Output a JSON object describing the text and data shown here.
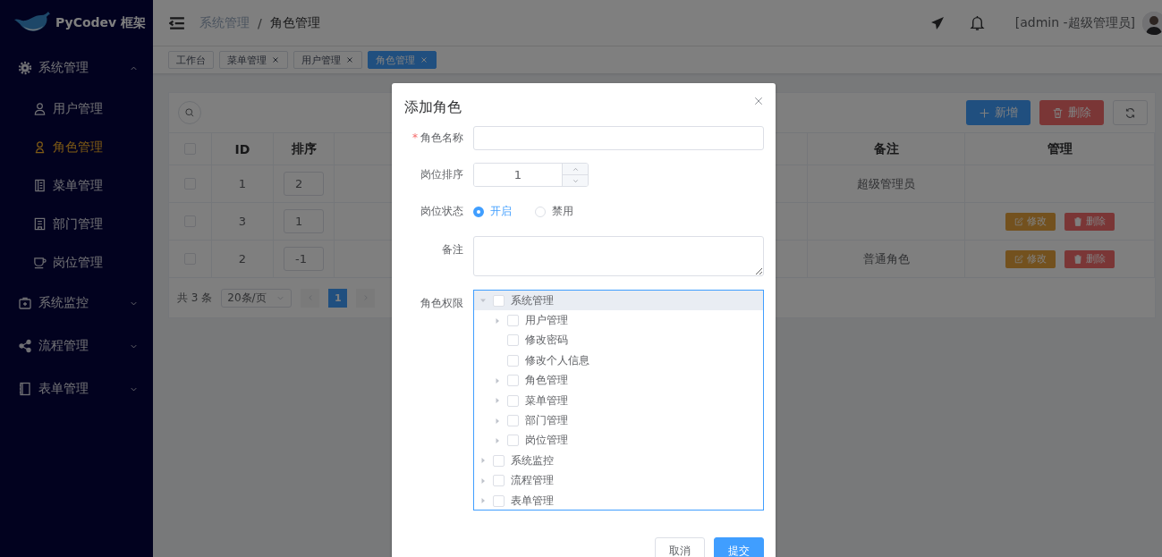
{
  "sidebar": {
    "logo": "PyCodev 框架",
    "items": [
      {
        "label": "系统管理",
        "expanded": true,
        "children": [
          {
            "label": "用户管理",
            "selected": false
          },
          {
            "label": "角色管理",
            "selected": true
          },
          {
            "label": "菜单管理",
            "selected": false
          },
          {
            "label": "部门管理",
            "selected": false
          },
          {
            "label": "岗位管理",
            "selected": false
          }
        ]
      },
      {
        "label": "系统监控",
        "expanded": false
      },
      {
        "label": "流程管理",
        "expanded": false
      },
      {
        "label": "表单管理",
        "expanded": false
      }
    ]
  },
  "header": {
    "breadcrumb": [
      "系统管理",
      "角色管理"
    ],
    "separator": "/",
    "user": "[admin -超级管理员]"
  },
  "tabs": [
    {
      "label": "工作台",
      "closable": false,
      "selected": false
    },
    {
      "label": "菜单管理",
      "closable": true,
      "selected": false
    },
    {
      "label": "用户管理",
      "closable": true,
      "selected": false
    },
    {
      "label": "角色管理",
      "closable": true,
      "selected": true
    }
  ],
  "toolbar": {
    "add": "新增",
    "delete": "删除"
  },
  "table": {
    "header_checked": false,
    "columns": [
      "ID",
      "排序",
      "备注",
      "管理"
    ],
    "rows": [
      {
        "checked": false,
        "id": "1",
        "order": "2",
        "note": "超级管理员",
        "actions": []
      },
      {
        "checked": false,
        "id": "3",
        "order": "1",
        "note": "",
        "actions": [
          {
            "kind": "edit",
            "label": "修改"
          },
          {
            "kind": "delete",
            "label": "删除"
          }
        ]
      },
      {
        "checked": false,
        "id": "2",
        "order": "-1",
        "note": "普通角色",
        "actions": [
          {
            "kind": "edit",
            "label": "修改"
          },
          {
            "kind": "delete",
            "label": "删除"
          }
        ]
      }
    ]
  },
  "pagination": {
    "total": "共 3 条",
    "page_size": "20条/页",
    "pages": [
      {
        "label": "1",
        "selected": true
      }
    ]
  },
  "dialog": {
    "title": "添加角色",
    "name_field": {
      "label": "角色名称",
      "required_mark": "*"
    },
    "order_field": {
      "label": "岗位排序",
      "value": "1"
    },
    "status_field": {
      "label": "岗位状态",
      "options": [
        {
          "label": "开启",
          "selected": true
        },
        {
          "label": "禁用",
          "selected": false
        }
      ]
    },
    "note_field": {
      "label": "备注"
    },
    "permissions": {
      "label": "角色权限",
      "tree": [
        {
          "label": "系统管理",
          "expanded": true,
          "checked": false,
          "selected": true,
          "children": [
            {
              "label": "用户管理",
              "expanded": false,
              "checked": false,
              "selected": false
            },
            {
              "label": "修改密码",
              "checked": false,
              "selected": false
            },
            {
              "label": "修改个人信息",
              "checked": false,
              "selected": false
            },
            {
              "label": "角色管理",
              "expanded": false,
              "checked": false,
              "selected": false
            },
            {
              "label": "菜单管理",
              "expanded": false,
              "checked": false,
              "selected": false
            },
            {
              "label": "部门管理",
              "expanded": false,
              "checked": false,
              "selected": false
            },
            {
              "label": "岗位管理",
              "expanded": false,
              "checked": false,
              "selected": false
            }
          ]
        },
        {
          "label": "系统监控",
          "expanded": false,
          "checked": false,
          "selected": false
        },
        {
          "label": "流程管理",
          "expanded": false,
          "checked": false,
          "selected": false
        },
        {
          "label": "表单管理",
          "expanded": false,
          "checked": false,
          "selected": false
        }
      ]
    },
    "buttons": {
      "cancel": "取消",
      "submit": "提交"
    }
  }
}
